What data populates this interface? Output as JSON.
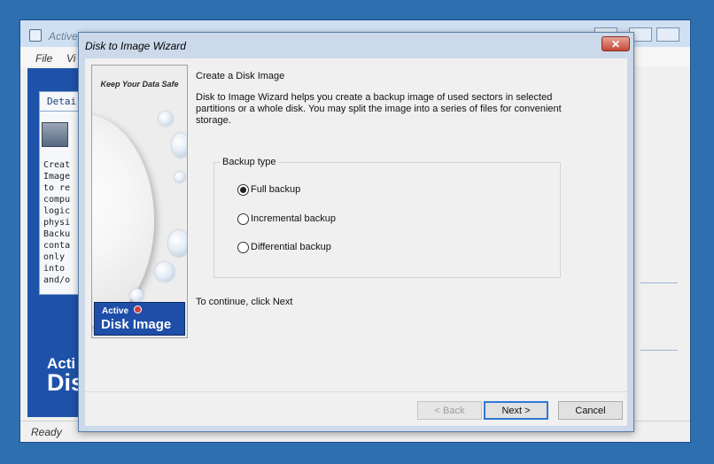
{
  "main_window": {
    "title": "Active",
    "menu": [
      "File",
      "Vi"
    ],
    "details_tab": "Detai",
    "details_text": "Creat\nImage\nto re\ncompu\nlogic\nphysi\nBacku\nconta\nonly \ninto \nand/o",
    "brand_line1": "Acti",
    "brand_line2": "Dis",
    "status": "Ready"
  },
  "wizard": {
    "title": "Disk to Image Wizard",
    "close_glyph": "✕",
    "side_banner": {
      "tagline": "Keep Your Data Safe",
      "logo_line1": "Active",
      "logo_line2": "Disk Image"
    },
    "heading": "Create a Disk Image",
    "description": "Disk to Image Wizard helps you create a backup image of used sectors in selected partitions or a whole disk. You may split the image into a series of files for convenient storage.",
    "backup_group": {
      "legend": "Backup type",
      "options": [
        {
          "label": "Full backup",
          "checked": true
        },
        {
          "label": "Incremental backup",
          "checked": false
        },
        {
          "label": "Differential backup",
          "checked": false
        }
      ]
    },
    "continue_hint": "To continue, click Next",
    "buttons": {
      "back": "< Back",
      "next": "Next >",
      "cancel": "Cancel"
    }
  }
}
